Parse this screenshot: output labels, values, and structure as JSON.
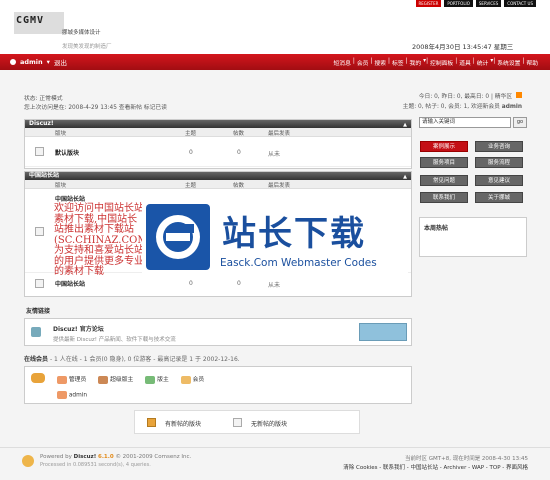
{
  "toplinks": [
    "REGISTER",
    "PORTFOLIO",
    "SERVICES",
    "CONTACT US"
  ],
  "header": {
    "logo": "CGMV",
    "logo_sub": "挪城多媒体设计",
    "slogan": "发现美发现的制造厂",
    "datetime": "2008年4月30日 13:45:47 星期三"
  },
  "nav": {
    "user": "admin",
    "logout": "退出",
    "items": [
      "短消息",
      "会员",
      "搜索",
      "标签",
      "我的",
      "控制面板",
      "道具",
      "统计",
      "系统设置",
      "帮助"
    ]
  },
  "status": {
    "line1": "状态: 正常模式",
    "line2": "您上次访问是在: 2008-4-29 13:45 查看新帖  标记已读",
    "right1": "今日: 0, 昨日: 0, 最高日: 0 | 精华区",
    "right2": "主题: 0, 帖子: 0, 会员: 1, 欢迎新会员",
    "new_member": "admin"
  },
  "forum1": {
    "title": "Discuz!",
    "cols": [
      "版块",
      "主题",
      "帖数",
      "最后发表"
    ],
    "rows": [
      {
        "name": "默认版块",
        "topics": "0",
        "posts": "0",
        "last": "从未"
      }
    ]
  },
  "forum2": {
    "title": "中国站长站",
    "cols": [
      "版块",
      "主题",
      "帖数",
      "最后发表"
    ],
    "rows": [
      {
        "name": "中国站长站",
        "topics": "",
        "posts": "",
        "last": ""
      },
      {
        "name": "中国站长站",
        "topics": "0",
        "posts": "0",
        "last": "从未"
      }
    ]
  },
  "watermark": {
    "handwritten": "欢迎访问中国站长站素材下载,中国站长站推出素材下载站(SC.CHINAZ.COM),为支持和喜爱站长站的用户提供更多专业的素材下载",
    "cn": "站长下载",
    "en": "Easck.Com Webmaster Codes"
  },
  "sidebar": {
    "search_placeholder": "请输入关键词",
    "search_btn": "go",
    "buttons": [
      "案例展示",
      "业务咨询",
      "服务项目",
      "服务流程",
      "常见问题",
      "意见建议",
      "联系我们",
      "关于挪城"
    ],
    "hot_title": "本周热帖"
  },
  "links": {
    "title": "友情链接",
    "name": "Discuz! 官方论坛",
    "desc": "提供最新 Discuz! 产品新闻、软件下载与技术交流"
  },
  "online": {
    "title": "在线会员",
    "summary": "- 1 人在线 - 1 会员(0 隐身), 0 位游客 - 最高记录是 1 于 2002-12-16.",
    "roles": [
      "管理员",
      "超级版主",
      "版主",
      "会员"
    ],
    "user": "admin"
  },
  "legend": {
    "new": "有新帖的版块",
    "none": "无新帖的版块"
  },
  "footer": {
    "powered": "Powered by",
    "product": "Discuz!",
    "version": "6.1.0",
    "copyright": "© 2001-2009 Comsenz Inc.",
    "processed": "Processed in 0.089531 second(s), 4 queries.",
    "time": "当前时区 GMT+8, 现在时间是 2008-4-30 13:45",
    "links": "清除 Cookies - 联系我们 - 中国站长站 - Archiver - WAP - TOP - 界面风格"
  },
  "colors": {
    "accent": "#c40f15",
    "header_bg": "#ffffff",
    "panel_head": "#444444"
  }
}
